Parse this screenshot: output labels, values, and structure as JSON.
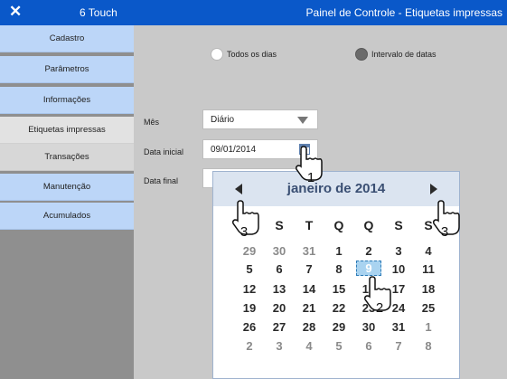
{
  "titlebar": {
    "close_glyph": "✕",
    "app_name": "6 Touch",
    "window_title": "Painel de Controle - Etiquetas impressas"
  },
  "sidebar": {
    "items": [
      {
        "label": "Cadastro"
      },
      {
        "label": "Parâmetros"
      },
      {
        "label": "Informações"
      },
      {
        "label": "Etiquetas impressas"
      },
      {
        "label": "Transações"
      },
      {
        "label": "Manutenção"
      },
      {
        "label": "Acumulados"
      }
    ],
    "active_index": 3
  },
  "filter": {
    "option_all_days": "Todos os dias",
    "option_date_range": "Intervalo de datas",
    "selected": "Intervalo de datas"
  },
  "form": {
    "month_label": "Mês",
    "month_value": "Diário",
    "start_label": "Data inicial",
    "start_value": "09/01/2014",
    "end_label": "Data final",
    "end_value": ""
  },
  "calendar": {
    "title": "janeiro de 2014",
    "weekdays": [
      "D",
      "S",
      "T",
      "Q",
      "Q",
      "S",
      "S"
    ],
    "weeks": [
      [
        "29",
        "30",
        "31",
        "1",
        "2",
        "3",
        "4"
      ],
      [
        "5",
        "6",
        "7",
        "8",
        "9",
        "10",
        "11"
      ],
      [
        "12",
        "13",
        "14",
        "15",
        "16",
        "17",
        "18"
      ],
      [
        "19",
        "20",
        "21",
        "22",
        "23",
        "24",
        "25"
      ],
      [
        "26",
        "27",
        "28",
        "29",
        "30",
        "31",
        "1"
      ],
      [
        "2",
        "3",
        "4",
        "5",
        "6",
        "7",
        "8"
      ]
    ],
    "selected_day": "9"
  },
  "annotations": {
    "step_icon": "1",
    "step_day": "2",
    "step_prev": "3",
    "step_next": "3"
  },
  "colors": {
    "titlebar": "#0a58c9",
    "nav_item": "#bcd6f8",
    "selected_day": "#a9d3f0"
  }
}
